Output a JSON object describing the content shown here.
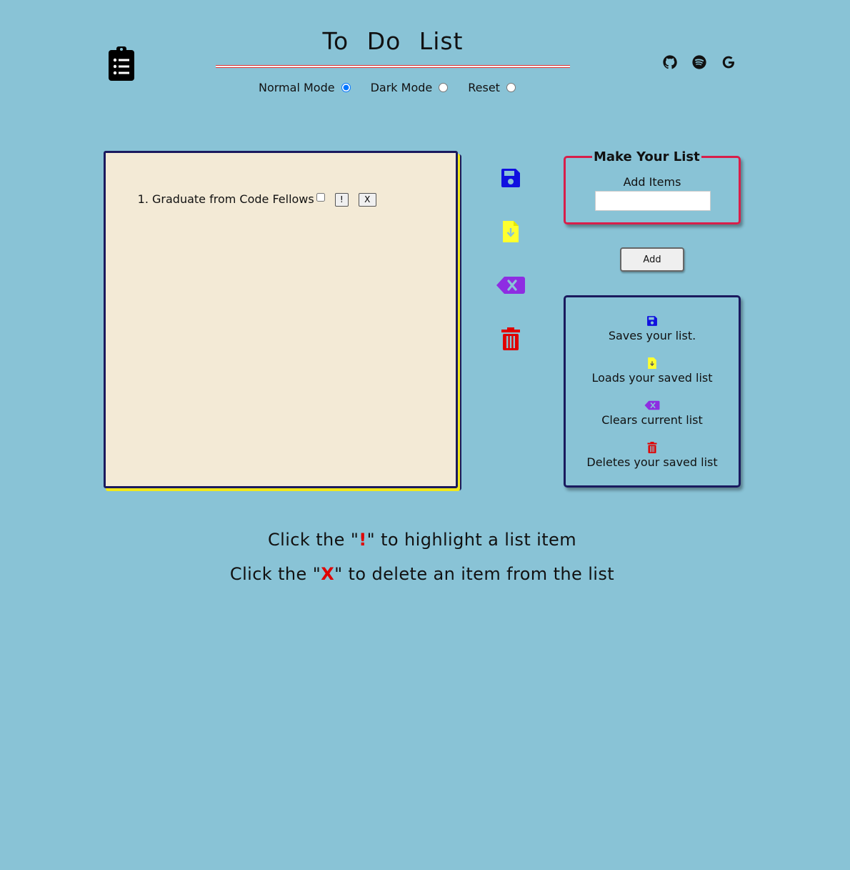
{
  "header": {
    "title": "To Do List",
    "modes": [
      {
        "label": "Normal Mode",
        "checked": true
      },
      {
        "label": "Dark Mode",
        "checked": false
      },
      {
        "label": "Reset",
        "checked": false
      }
    ],
    "social_icons": [
      "github-icon",
      "spotify-icon",
      "google-icon"
    ],
    "logo_icon": "clipboard-list-icon"
  },
  "list": {
    "items": [
      {
        "number": "1.",
        "text": "Graduate from Code Fellows",
        "done": false,
        "highlight_label": "!",
        "delete_label": "X"
      }
    ]
  },
  "tools": [
    {
      "icon": "save-icon",
      "color": "#1010e0"
    },
    {
      "icon": "load-file-icon",
      "color": "#ffff2e"
    },
    {
      "icon": "clear-backspace-icon",
      "color": "#8e2de2"
    },
    {
      "icon": "trash-icon",
      "color": "#e00000"
    }
  ],
  "form": {
    "legend": "Make Your List",
    "label": "Add Items",
    "input_value": "",
    "button_label": "Add"
  },
  "legend": [
    {
      "icon": "save-icon",
      "text": "Saves your list."
    },
    {
      "icon": "load-file-icon",
      "text": "Loads your saved list"
    },
    {
      "icon": "clear-backspace-icon",
      "text": "Clears current list"
    },
    {
      "icon": "trash-icon",
      "text": "Deletes your saved list"
    }
  ],
  "instructions": {
    "line1_before": "Click the \"",
    "line1_mark": "!",
    "line1_after": "\" to highlight a list item",
    "line2_before": "Click the \"",
    "line2_mark": "X",
    "line2_after": "\" to delete an item from the list"
  }
}
